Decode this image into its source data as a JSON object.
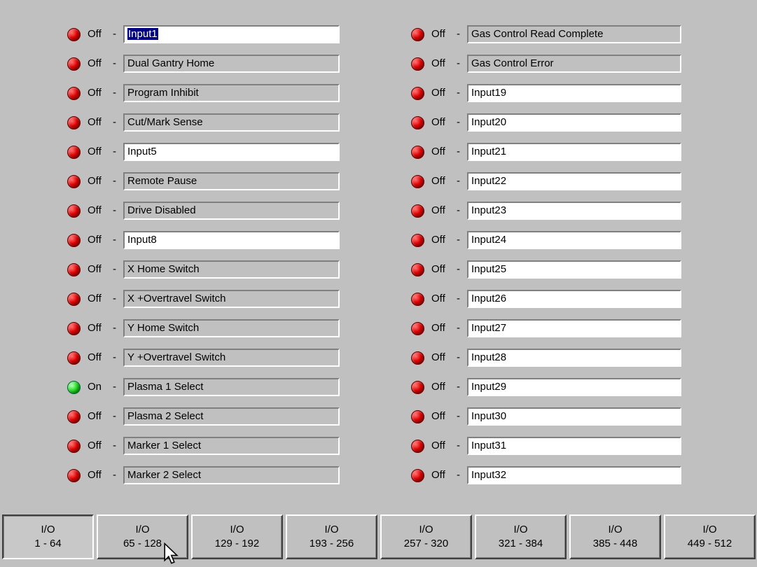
{
  "left_column": [
    {
      "state": "Off",
      "label": "Input1",
      "editable": true,
      "selected": true
    },
    {
      "state": "Off",
      "label": "Dual Gantry Home",
      "editable": false
    },
    {
      "state": "Off",
      "label": "Program Inhibit",
      "editable": false
    },
    {
      "state": "Off",
      "label": "Cut/Mark Sense",
      "editable": false
    },
    {
      "state": "Off",
      "label": "Input5",
      "editable": true
    },
    {
      "state": "Off",
      "label": "Remote Pause",
      "editable": false
    },
    {
      "state": "Off",
      "label": "Drive Disabled",
      "editable": false
    },
    {
      "state": "Off",
      "label": "Input8",
      "editable": true
    },
    {
      "state": "Off",
      "label": "X Home Switch",
      "editable": false
    },
    {
      "state": "Off",
      "label": "X +Overtravel Switch",
      "editable": false
    },
    {
      "state": "Off",
      "label": "Y Home Switch",
      "editable": false
    },
    {
      "state": "Off",
      "label": "Y +Overtravel Switch",
      "editable": false
    },
    {
      "state": "On",
      "label": "Plasma 1 Select",
      "editable": false
    },
    {
      "state": "Off",
      "label": "Plasma 2 Select",
      "editable": false
    },
    {
      "state": "Off",
      "label": "Marker 1 Select",
      "editable": false
    },
    {
      "state": "Off",
      "label": "Marker 2 Select",
      "editable": false
    }
  ],
  "right_column": [
    {
      "state": "Off",
      "label": "Gas Control Read Complete",
      "editable": false
    },
    {
      "state": "Off",
      "label": "Gas Control Error",
      "editable": false
    },
    {
      "state": "Off",
      "label": "Input19",
      "editable": true
    },
    {
      "state": "Off",
      "label": "Input20",
      "editable": true
    },
    {
      "state": "Off",
      "label": "Input21",
      "editable": true
    },
    {
      "state": "Off",
      "label": "Input22",
      "editable": true
    },
    {
      "state": "Off",
      "label": "Input23",
      "editable": true
    },
    {
      "state": "Off",
      "label": "Input24",
      "editable": true
    },
    {
      "state": "Off",
      "label": "Input25",
      "editable": true
    },
    {
      "state": "Off",
      "label": "Input26",
      "editable": true
    },
    {
      "state": "Off",
      "label": "Input27",
      "editable": true
    },
    {
      "state": "Off",
      "label": "Input28",
      "editable": true
    },
    {
      "state": "Off",
      "label": "Input29",
      "editable": true
    },
    {
      "state": "Off",
      "label": "Input30",
      "editable": true
    },
    {
      "state": "Off",
      "label": "Input31",
      "editable": true
    },
    {
      "state": "Off",
      "label": "Input32",
      "editable": true
    }
  ],
  "separator": "-",
  "tabs": [
    {
      "line1": "I/O",
      "line2": "1 - 64",
      "active": true
    },
    {
      "line1": "I/O",
      "line2": "65 - 128",
      "active": false
    },
    {
      "line1": "I/O",
      "line2": "129 - 192",
      "active": false
    },
    {
      "line1": "I/O",
      "line2": "193 - 256",
      "active": false
    },
    {
      "line1": "I/O",
      "line2": "257 - 320",
      "active": false
    },
    {
      "line1": "I/O",
      "line2": "321 - 384",
      "active": false
    },
    {
      "line1": "I/O",
      "line2": "385 - 448",
      "active": false
    },
    {
      "line1": "I/O",
      "line2": "449 - 512",
      "active": false
    }
  ],
  "colors": {
    "background": "#c0c0c0",
    "led_off": "#e00000",
    "led_on": "#22dd22",
    "selection": "#000080"
  },
  "icons": {
    "led": "status-led-icon",
    "cursor": "mouse-pointer-icon"
  }
}
